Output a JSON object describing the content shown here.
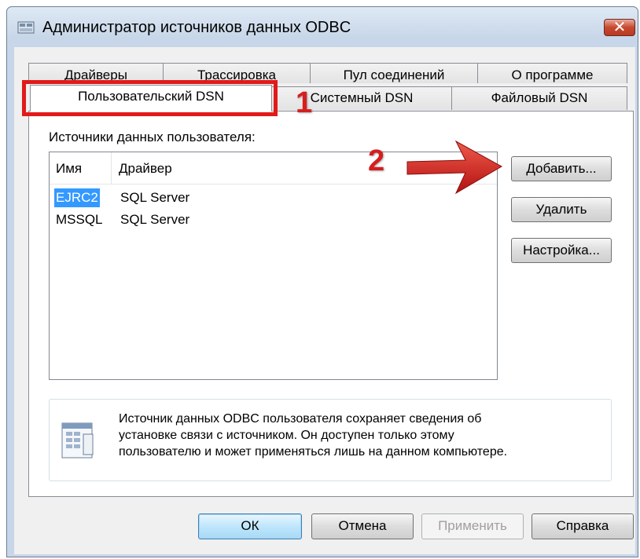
{
  "window": {
    "title": "Администратор источников данных ODBC",
    "close_glyph": "✕"
  },
  "tabs": {
    "back_row": [
      "Драйверы",
      "Трассировка",
      "Пул соединений",
      "О программе"
    ],
    "front_row": [
      "Пользовательский DSN",
      "Системный DSN",
      "Файловый DSN"
    ],
    "selected": "Пользовательский DSN"
  },
  "panel": {
    "group_label": "Источники данных пользователя:",
    "columns": [
      "Имя",
      "Драйвер"
    ],
    "rows": [
      {
        "name": "EJRC2",
        "driver": "SQL Server",
        "selected": true
      },
      {
        "name": "MSSQL",
        "driver": "SQL Server",
        "selected": false
      }
    ],
    "buttons": {
      "add": "Добавить...",
      "remove": "Удалить",
      "configure": "Настройка..."
    },
    "info_text": [
      "Источник данных ODBC пользователя сохраняет сведения об",
      "установке связи с источником.  Он доступен только этому",
      "пользователю и может применяться лишь на данном компьютере."
    ]
  },
  "footer": {
    "ok": "ОК",
    "cancel": "Отмена",
    "apply": "Применить",
    "help": "Справка"
  },
  "annotations": {
    "step1": "1",
    "step2": "2",
    "color": "#e21a1a"
  },
  "icons": [
    "odbc-window-icon",
    "close-icon",
    "info-document-icon",
    "red-arrow-icon"
  ]
}
